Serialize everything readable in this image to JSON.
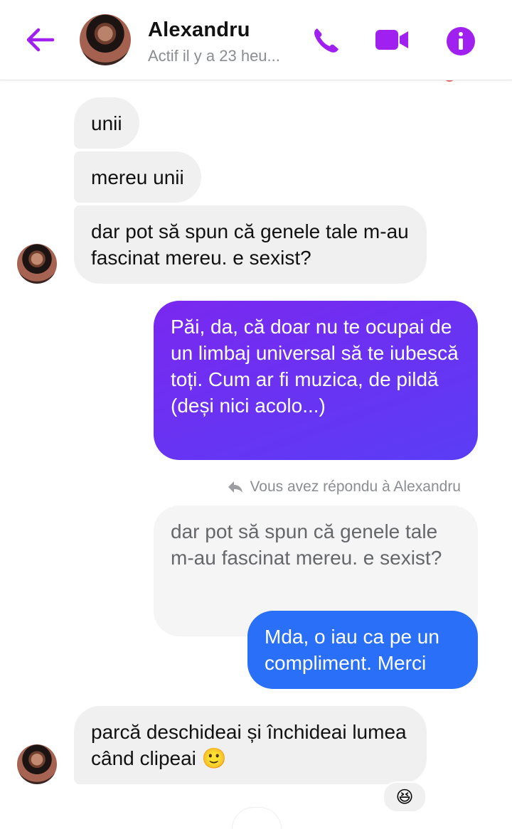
{
  "header": {
    "name": "Alexandru",
    "status": "Actif il y a 23 heu..."
  },
  "colors": {
    "accent": "#a020f0",
    "outgoing_gradient_start": "#7a28f0",
    "outgoing_gradient_end": "#5a3df5",
    "outgoing_blue": "#2a6ff7",
    "incoming": "#f0f0f0"
  },
  "icons": {
    "back": "arrow-left-icon",
    "call": "phone-icon",
    "video": "video-camera-icon",
    "info": "info-icon",
    "reply": "reply-arrow-icon"
  },
  "messages": [
    {
      "sender": "Alexandru",
      "text": "unii"
    },
    {
      "sender": "Alexandru",
      "text": "mereu unii"
    },
    {
      "sender": "Alexandru",
      "text": "dar pot să spun că genele tale m-au fascinat mereu. e sexist?"
    },
    {
      "sender": "me",
      "text": "Păi, da, că doar nu te ocupai de un limbaj universal să te iubescă toți. Cum ar fi muzica, de pildă (deși nici acolo...)"
    },
    {
      "sender": "me",
      "reply_note": "Vous avez répondu à Alexandru",
      "quoted": "dar pot să spun că genele tale m-au fascinat mereu. e sexist?",
      "text": "Mda, o iau ca pe un compliment. Merci"
    },
    {
      "sender": "Alexandru",
      "text": "parcă deschideai și închideai lumea când clipeai 🙂",
      "reaction": "😆"
    }
  ]
}
